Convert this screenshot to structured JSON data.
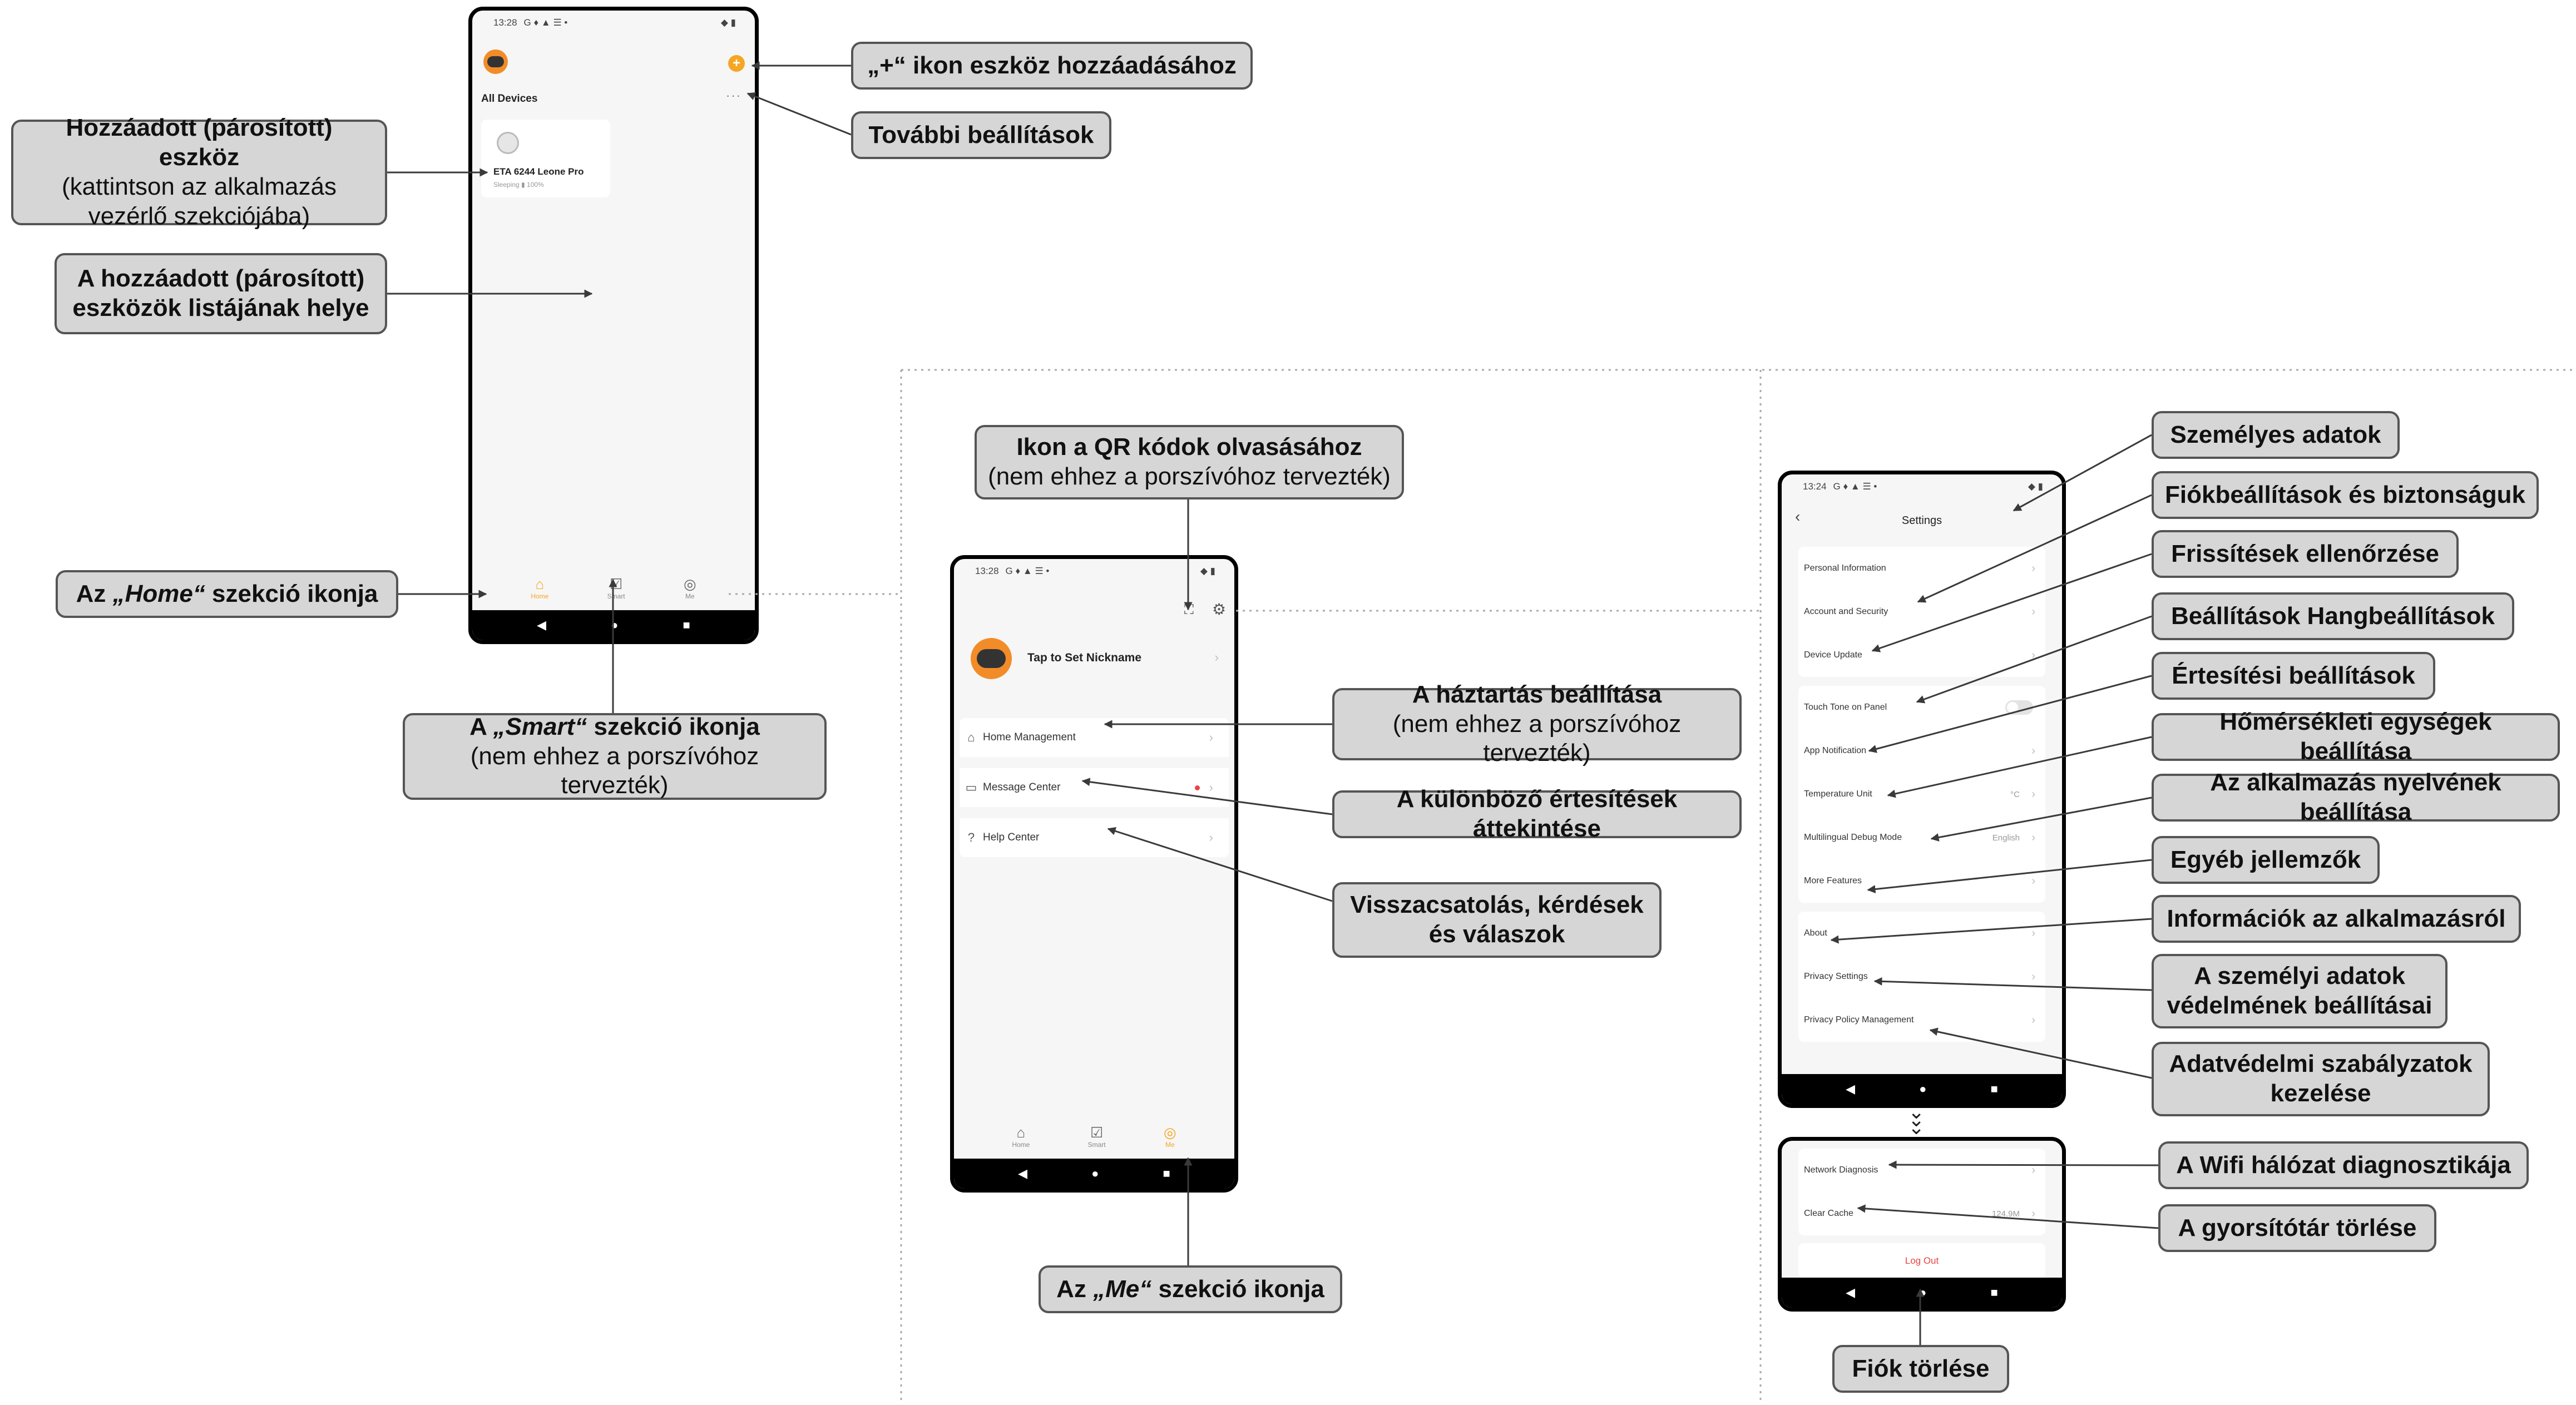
{
  "colors": {
    "accent": "#f5a623",
    "callout_bg": "#d6d6d6",
    "callout_border": "#555555",
    "logout": "#e84545",
    "notification_dot": "#e84545"
  },
  "phone1": {
    "status_time": "13:28",
    "status_icons": "G ♦ ▲ ☰ •",
    "status_right": "◆ ▮",
    "section_title": "All Devices",
    "add_icon": "plus-circle-icon",
    "more_icon": "ellipsis-icon",
    "device": {
      "name": "ETA 6244 Leone Pro",
      "status": "Sleeping",
      "battery": "100%"
    },
    "tabs": [
      {
        "label": "Home",
        "icon": "home-icon"
      },
      {
        "label": "Smart",
        "icon": "smart-icon"
      },
      {
        "label": "Me",
        "icon": "me-icon"
      }
    ],
    "nav": [
      "◀",
      "●",
      "■"
    ]
  },
  "phone2": {
    "status_time": "13:28",
    "status_icons": "G ♦ ▲ ☰ •",
    "status_right": "◆ ▮",
    "nickname": "Tap to Set Nickname",
    "menu": [
      {
        "label": "Home Management",
        "icon": "home-icon"
      },
      {
        "label": "Message Center",
        "icon": "message-icon"
      },
      {
        "label": "Help Center",
        "icon": "help-icon"
      }
    ],
    "tabs": [
      {
        "label": "Home",
        "icon": "home-icon"
      },
      {
        "label": "Smart",
        "icon": "smart-icon"
      },
      {
        "label": "Me",
        "icon": "me-icon"
      }
    ],
    "nav": [
      "◀",
      "●",
      "■"
    ]
  },
  "phone3": {
    "status_time": "13:24",
    "status_icons": "G ♦ ▲ ☰ •",
    "status_right": "◆ ▮",
    "title": "Settings",
    "rows": [
      {
        "label": "Personal Information",
        "value": ""
      },
      {
        "label": "Account and Security",
        "value": ""
      },
      {
        "label": "Device Update",
        "value": ""
      },
      {
        "label": "Touch Tone on Panel",
        "value": ""
      },
      {
        "label": "App Notification",
        "value": ""
      },
      {
        "label": "Temperature Unit",
        "value": "°C"
      },
      {
        "label": "Multilingual Debug Mode",
        "value": "English"
      },
      {
        "label": "More Features",
        "value": ""
      },
      {
        "label": "About",
        "value": ""
      },
      {
        "label": "Privacy Settings",
        "value": ""
      },
      {
        "label": "Privacy Policy Management",
        "value": ""
      }
    ],
    "nav": [
      "◀",
      "●",
      "■"
    ]
  },
  "phone4": {
    "rows": [
      {
        "label": "Network Diagnosis",
        "value": ""
      },
      {
        "label": "Clear Cache",
        "value": "124.9M"
      }
    ],
    "logout": "Log Out",
    "nav": [
      "◀",
      "●",
      "■"
    ]
  },
  "callouts": {
    "add_device": "„+“ ikon eszköz hozzáadásához",
    "more_settings": "További beállítások",
    "added_device_title": "Hozzáadott (párosított) eszköz",
    "added_device_sub": "(kattintson az alkalmazás vezérlő szekciójába)",
    "device_list_place": "A hozzáadott (párosított) eszközök listájának helye",
    "home_pre": "Az ",
    "home_word": "„Home“",
    "home_post": " szekció ikonja",
    "smart_pre": "A ",
    "smart_word": "„Smart“",
    "smart_post": " szekció ikonja",
    "smart_sub": "(nem ehhez a porszívóhoz tervezték)",
    "qr_title": "Ikon a QR kódok olvasásához",
    "qr_sub": "(nem ehhez a porszívóhoz tervezték)",
    "household_title": "A háztartás beállítása",
    "household_sub": "(nem ehhez a porszívóhoz tervezték)",
    "notifications_overview": "A különböző értesítések áttekintése",
    "feedback": "Visszacsatolás, kérdések és válaszok",
    "me_pre": "Az ",
    "me_word": "„Me“",
    "me_post": " szekció ikonja",
    "personal_data": "Személyes adatok",
    "account_security": "Fiókbeállítások és biztonságuk",
    "updates_check": "Frissítések ellenőrzése",
    "sound_settings": "Beállítások Hangbeállítások",
    "notification_settings": "Értesítési beállítások",
    "temperature_units": "Hőmérsékleti egységek beállítása",
    "app_language": "Az alkalmazás nyelvének beállítása",
    "other_features": "Egyéb jellemzők",
    "app_info": "Információk az alkalmazásról",
    "privacy_settings": "A személyi adatok védelmének beállításai",
    "privacy_policy": "Adatvédelmi szabályzatok kezelése",
    "wifi_diag": "A Wifi hálózat diagnosztikája",
    "clear_cache": "A gyorsítótár törlése",
    "delete_account": "Fiók törlése"
  }
}
